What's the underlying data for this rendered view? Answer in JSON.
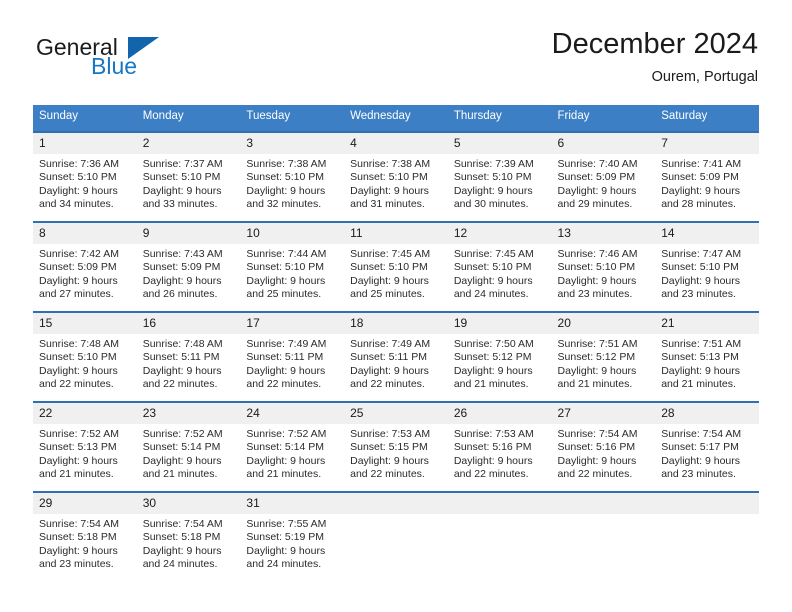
{
  "brand": {
    "name_part1": "General",
    "name_part2": "Blue",
    "triangle_color": "#1265ad",
    "blue_color": "#1777c4"
  },
  "header": {
    "month_title": "December 2024",
    "location": "Ourem, Portugal"
  },
  "calendar": {
    "header_bg": "#3c7fc4",
    "row_border_color": "#2f6fb2",
    "daynum_band_bg": "#f0f0f0",
    "weekday_headers": [
      "Sunday",
      "Monday",
      "Tuesday",
      "Wednesday",
      "Thursday",
      "Friday",
      "Saturday"
    ],
    "weeks": [
      [
        {
          "day": "1",
          "sunrise": "Sunrise: 7:36 AM",
          "sunset": "Sunset: 5:10 PM",
          "daylight_line1": "Daylight: 9 hours",
          "daylight_line2": "and 34 minutes."
        },
        {
          "day": "2",
          "sunrise": "Sunrise: 7:37 AM",
          "sunset": "Sunset: 5:10 PM",
          "daylight_line1": "Daylight: 9 hours",
          "daylight_line2": "and 33 minutes."
        },
        {
          "day": "3",
          "sunrise": "Sunrise: 7:38 AM",
          "sunset": "Sunset: 5:10 PM",
          "daylight_line1": "Daylight: 9 hours",
          "daylight_line2": "and 32 minutes."
        },
        {
          "day": "4",
          "sunrise": "Sunrise: 7:38 AM",
          "sunset": "Sunset: 5:10 PM",
          "daylight_line1": "Daylight: 9 hours",
          "daylight_line2": "and 31 minutes."
        },
        {
          "day": "5",
          "sunrise": "Sunrise: 7:39 AM",
          "sunset": "Sunset: 5:10 PM",
          "daylight_line1": "Daylight: 9 hours",
          "daylight_line2": "and 30 minutes."
        },
        {
          "day": "6",
          "sunrise": "Sunrise: 7:40 AM",
          "sunset": "Sunset: 5:09 PM",
          "daylight_line1": "Daylight: 9 hours",
          "daylight_line2": "and 29 minutes."
        },
        {
          "day": "7",
          "sunrise": "Sunrise: 7:41 AM",
          "sunset": "Sunset: 5:09 PM",
          "daylight_line1": "Daylight: 9 hours",
          "daylight_line2": "and 28 minutes."
        }
      ],
      [
        {
          "day": "8",
          "sunrise": "Sunrise: 7:42 AM",
          "sunset": "Sunset: 5:09 PM",
          "daylight_line1": "Daylight: 9 hours",
          "daylight_line2": "and 27 minutes."
        },
        {
          "day": "9",
          "sunrise": "Sunrise: 7:43 AM",
          "sunset": "Sunset: 5:09 PM",
          "daylight_line1": "Daylight: 9 hours",
          "daylight_line2": "and 26 minutes."
        },
        {
          "day": "10",
          "sunrise": "Sunrise: 7:44 AM",
          "sunset": "Sunset: 5:10 PM",
          "daylight_line1": "Daylight: 9 hours",
          "daylight_line2": "and 25 minutes."
        },
        {
          "day": "11",
          "sunrise": "Sunrise: 7:45 AM",
          "sunset": "Sunset: 5:10 PM",
          "daylight_line1": "Daylight: 9 hours",
          "daylight_line2": "and 25 minutes."
        },
        {
          "day": "12",
          "sunrise": "Sunrise: 7:45 AM",
          "sunset": "Sunset: 5:10 PM",
          "daylight_line1": "Daylight: 9 hours",
          "daylight_line2": "and 24 minutes."
        },
        {
          "day": "13",
          "sunrise": "Sunrise: 7:46 AM",
          "sunset": "Sunset: 5:10 PM",
          "daylight_line1": "Daylight: 9 hours",
          "daylight_line2": "and 23 minutes."
        },
        {
          "day": "14",
          "sunrise": "Sunrise: 7:47 AM",
          "sunset": "Sunset: 5:10 PM",
          "daylight_line1": "Daylight: 9 hours",
          "daylight_line2": "and 23 minutes."
        }
      ],
      [
        {
          "day": "15",
          "sunrise": "Sunrise: 7:48 AM",
          "sunset": "Sunset: 5:10 PM",
          "daylight_line1": "Daylight: 9 hours",
          "daylight_line2": "and 22 minutes."
        },
        {
          "day": "16",
          "sunrise": "Sunrise: 7:48 AM",
          "sunset": "Sunset: 5:11 PM",
          "daylight_line1": "Daylight: 9 hours",
          "daylight_line2": "and 22 minutes."
        },
        {
          "day": "17",
          "sunrise": "Sunrise: 7:49 AM",
          "sunset": "Sunset: 5:11 PM",
          "daylight_line1": "Daylight: 9 hours",
          "daylight_line2": "and 22 minutes."
        },
        {
          "day": "18",
          "sunrise": "Sunrise: 7:49 AM",
          "sunset": "Sunset: 5:11 PM",
          "daylight_line1": "Daylight: 9 hours",
          "daylight_line2": "and 22 minutes."
        },
        {
          "day": "19",
          "sunrise": "Sunrise: 7:50 AM",
          "sunset": "Sunset: 5:12 PM",
          "daylight_line1": "Daylight: 9 hours",
          "daylight_line2": "and 21 minutes."
        },
        {
          "day": "20",
          "sunrise": "Sunrise: 7:51 AM",
          "sunset": "Sunset: 5:12 PM",
          "daylight_line1": "Daylight: 9 hours",
          "daylight_line2": "and 21 minutes."
        },
        {
          "day": "21",
          "sunrise": "Sunrise: 7:51 AM",
          "sunset": "Sunset: 5:13 PM",
          "daylight_line1": "Daylight: 9 hours",
          "daylight_line2": "and 21 minutes."
        }
      ],
      [
        {
          "day": "22",
          "sunrise": "Sunrise: 7:52 AM",
          "sunset": "Sunset: 5:13 PM",
          "daylight_line1": "Daylight: 9 hours",
          "daylight_line2": "and 21 minutes."
        },
        {
          "day": "23",
          "sunrise": "Sunrise: 7:52 AM",
          "sunset": "Sunset: 5:14 PM",
          "daylight_line1": "Daylight: 9 hours",
          "daylight_line2": "and 21 minutes."
        },
        {
          "day": "24",
          "sunrise": "Sunrise: 7:52 AM",
          "sunset": "Sunset: 5:14 PM",
          "daylight_line1": "Daylight: 9 hours",
          "daylight_line2": "and 21 minutes."
        },
        {
          "day": "25",
          "sunrise": "Sunrise: 7:53 AM",
          "sunset": "Sunset: 5:15 PM",
          "daylight_line1": "Daylight: 9 hours",
          "daylight_line2": "and 22 minutes."
        },
        {
          "day": "26",
          "sunrise": "Sunrise: 7:53 AM",
          "sunset": "Sunset: 5:16 PM",
          "daylight_line1": "Daylight: 9 hours",
          "daylight_line2": "and 22 minutes."
        },
        {
          "day": "27",
          "sunrise": "Sunrise: 7:54 AM",
          "sunset": "Sunset: 5:16 PM",
          "daylight_line1": "Daylight: 9 hours",
          "daylight_line2": "and 22 minutes."
        },
        {
          "day": "28",
          "sunrise": "Sunrise: 7:54 AM",
          "sunset": "Sunset: 5:17 PM",
          "daylight_line1": "Daylight: 9 hours",
          "daylight_line2": "and 23 minutes."
        }
      ],
      [
        {
          "day": "29",
          "sunrise": "Sunrise: 7:54 AM",
          "sunset": "Sunset: 5:18 PM",
          "daylight_line1": "Daylight: 9 hours",
          "daylight_line2": "and 23 minutes."
        },
        {
          "day": "30",
          "sunrise": "Sunrise: 7:54 AM",
          "sunset": "Sunset: 5:18 PM",
          "daylight_line1": "Daylight: 9 hours",
          "daylight_line2": "and 24 minutes."
        },
        {
          "day": "31",
          "sunrise": "Sunrise: 7:55 AM",
          "sunset": "Sunset: 5:19 PM",
          "daylight_line1": "Daylight: 9 hours",
          "daylight_line2": "and 24 minutes."
        },
        {
          "day": "",
          "sunrise": "",
          "sunset": "",
          "daylight_line1": "",
          "daylight_line2": ""
        },
        {
          "day": "",
          "sunrise": "",
          "sunset": "",
          "daylight_line1": "",
          "daylight_line2": ""
        },
        {
          "day": "",
          "sunrise": "",
          "sunset": "",
          "daylight_line1": "",
          "daylight_line2": ""
        },
        {
          "day": "",
          "sunrise": "",
          "sunset": "",
          "daylight_line1": "",
          "daylight_line2": ""
        }
      ]
    ]
  }
}
